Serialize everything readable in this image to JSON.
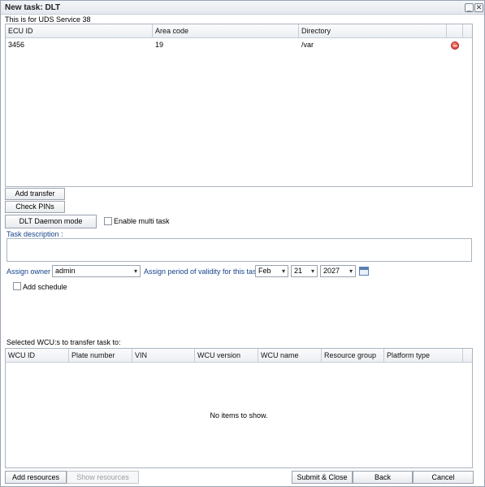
{
  "window": {
    "title": "New task: DLT",
    "minimize_glyph": "_",
    "close_glyph": "✕"
  },
  "subtitle": "This is for UDS Service 38",
  "transfers_grid": {
    "columns": [
      "ECU ID",
      "Area code",
      "Directory"
    ],
    "rows": [
      {
        "ecu_id": "3456",
        "area_code": "19",
        "directory": "/var"
      }
    ]
  },
  "buttons": {
    "add_transfer": "Add transfer",
    "check_pins": "Check PINs",
    "dlt_daemon_mode": "DLT Daemon mode",
    "add_resources": "Add resources",
    "show_resources": "Show resources",
    "submit_close": "Submit & Close",
    "back": "Back",
    "cancel": "Cancel"
  },
  "enable_multi_task": {
    "label": "Enable multi task",
    "checked": false
  },
  "task_description": {
    "label": "Task description :",
    "value": ""
  },
  "assign_owner": {
    "label": "Assign owner :",
    "value": "admin"
  },
  "validity": {
    "label": "Assign period of validity for this task :",
    "month": "Feb",
    "day": "21",
    "year": "2027"
  },
  "add_schedule": {
    "label": "Add schedule",
    "checked": false
  },
  "wcu_section": {
    "label": "Selected WCU:s to transfer task to:",
    "columns": [
      "WCU ID",
      "Plate number",
      "VIN",
      "WCU version",
      "WCU name",
      "Resource group",
      "Platform type"
    ],
    "empty_text": "No items to show."
  }
}
